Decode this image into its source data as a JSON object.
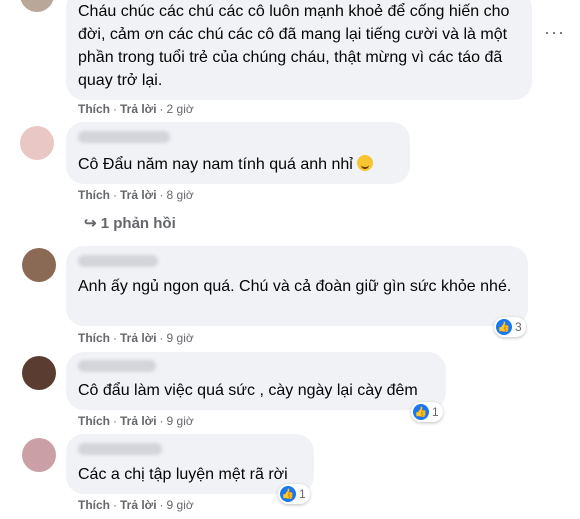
{
  "more_label": "···",
  "comments": [
    {
      "text": "Cháu chúc các chú các cô luôn mạnh khoẻ để cống hiến cho đời, cảm ơn các chú các cô đã mang lại tiếng cười và là một phần trong tuổi trẻ của chúng cháu, thật mừng vì các táo đã quay trở lại.",
      "like": "Thích",
      "reply": "Trả lời",
      "time": "2 giờ"
    },
    {
      "text": "Cô Đẩu năm nay nam tính quá anh nhỉ",
      "emoji": "grinning-face",
      "like": "Thích",
      "reply": "Trả lời",
      "time": "8 giờ",
      "replies_label": "↪ 1 phản hồi"
    },
    {
      "text": "Anh ấy ngủ ngon quá. Chú và cả đoàn giữ gìn sức khỏe nhé.",
      "like": "Thích",
      "reply": "Trả lời",
      "time": "9 giờ",
      "reactions": "3"
    },
    {
      "text": "Cô đẩu làm việc quá sức , cày ngày lại cày đêm",
      "like": "Thích",
      "reply": "Trả lời",
      "time": "9 giờ",
      "reactions": "1"
    },
    {
      "text": "Các a chị tập luyện mệt rã rời",
      "like": "Thích",
      "reply": "Trả lời",
      "time": "9 giờ",
      "reactions": "1"
    }
  ],
  "icons": {
    "reaction": "like-icon",
    "more": "more-options-icon"
  },
  "colors": {
    "bubble": "#f0f2f5",
    "meta": "#65676b",
    "like_blue": "#1877f2"
  }
}
